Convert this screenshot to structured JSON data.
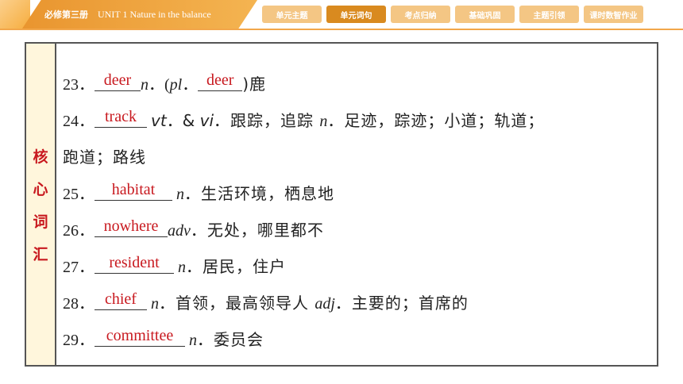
{
  "header": {
    "book": "必修第三册",
    "unit": "UNIT 1    Nature in the balance",
    "tabs": [
      {
        "label": "单元主题"
      },
      {
        "label": "单元词句"
      },
      {
        "label": "考点归纳"
      },
      {
        "label": "基础巩固"
      },
      {
        "label": "主题引领"
      },
      {
        "label": "课时数智作业"
      }
    ],
    "active_tab": "单元词句"
  },
  "side_label": [
    "核",
    "心",
    "词",
    "汇"
  ],
  "entries": [
    {
      "num": "23．",
      "answer": "deer",
      "pos": "n",
      "pl_prefix": "(",
      "pl": "pl",
      "pl_answer": "deer",
      "meaning": ")鹿"
    },
    {
      "num": "24．",
      "answer": "track",
      "pos_a": "vt",
      "amp": "．& ",
      "pos_b": "vi",
      "meaning_a": "．跟踪，追踪 ",
      "pos_c": "n",
      "meaning_b": "．足迹，踪迹；小道；轨道；",
      "cont": "跑道；路线"
    },
    {
      "num": "25．",
      "answer": "habitat",
      "pos": "n",
      "meaning": "．生活环境，栖息地"
    },
    {
      "num": "26．",
      "answer": "nowhere",
      "pos": "adv",
      "meaning": "．无处，哪里都不"
    },
    {
      "num": "27．",
      "answer": "resident",
      "pos": "n",
      "meaning": "．居民，住户"
    },
    {
      "num": "28．",
      "answer": "chief",
      "pos_a": "n",
      "meaning_a": "．首领，最高领导人 ",
      "pos_b": "adj",
      "meaning_b": "．主要的；首席的"
    },
    {
      "num": "29．",
      "answer": "committee",
      "pos": "n",
      "meaning": "．委员会"
    }
  ],
  "colors": {
    "accent": "#f2a64a",
    "answer_red": "#c8191f",
    "active_tab": "#d98a1f"
  }
}
